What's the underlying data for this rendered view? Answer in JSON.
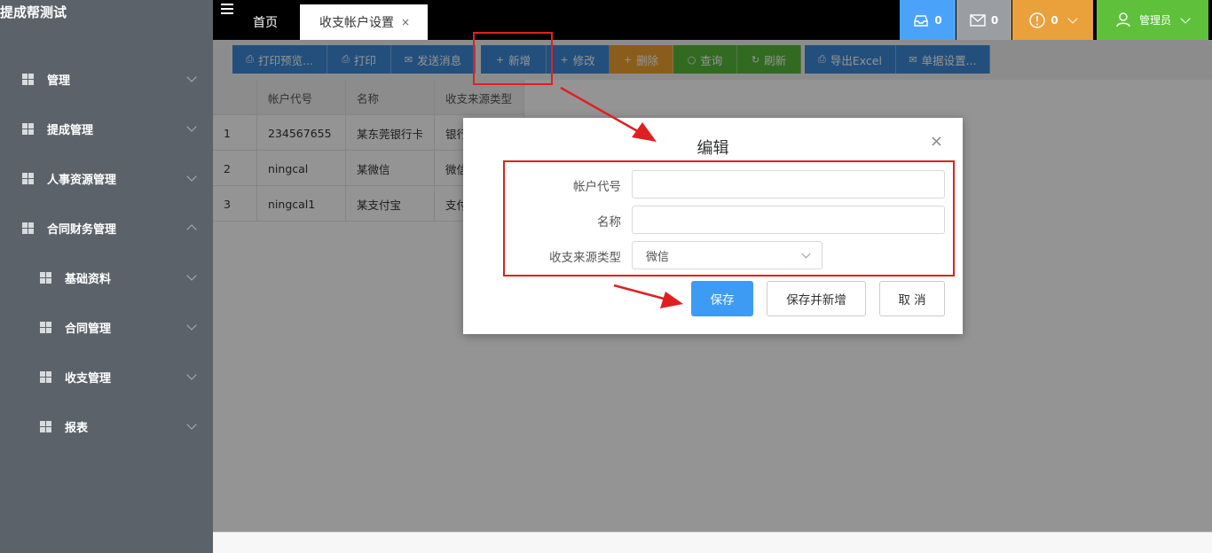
{
  "app": {
    "title": "提成帮测试"
  },
  "sidebar": {
    "items": [
      {
        "label": "管理",
        "expanded": false
      },
      {
        "label": "提成管理",
        "expanded": false
      },
      {
        "label": "人事资源管理",
        "expanded": false
      },
      {
        "label": "合同财务管理",
        "expanded": true
      },
      {
        "label": "基础资料",
        "expanded": false
      },
      {
        "label": "合同管理",
        "expanded": false
      },
      {
        "label": "收支管理",
        "expanded": false
      },
      {
        "label": "报表",
        "expanded": false
      }
    ]
  },
  "topbar": {
    "tabs": [
      {
        "label": "首页"
      },
      {
        "label": "收支帐户设置",
        "close": "×"
      }
    ],
    "inbox_count": "0",
    "mail_count": "0",
    "alert_count": "0",
    "user_label": "管理员"
  },
  "toolbar": {
    "buttons": [
      {
        "icon": "⎙",
        "label": "打印预览..."
      },
      {
        "icon": "⎙",
        "label": "打印"
      },
      {
        "icon": "✉",
        "label": "发送消息"
      },
      {
        "icon": "+",
        "label": "新增"
      },
      {
        "icon": "+",
        "label": "修改"
      },
      {
        "icon": "+",
        "label": "删除"
      },
      {
        "icon": "○",
        "label": "查询"
      },
      {
        "icon": "↻",
        "label": "刷新"
      },
      {
        "icon": "⎙",
        "label": "导出Excel"
      },
      {
        "icon": "✉",
        "label": "单据设置..."
      }
    ]
  },
  "table": {
    "headers": [
      "",
      "帐户代号",
      "名称",
      "收支来源类型"
    ],
    "rows": [
      [
        "1",
        "234567655",
        "某东莞银行卡",
        "银行"
      ],
      [
        "2",
        "ningcal",
        "某微信",
        "微信"
      ],
      [
        "3",
        "ningcal1",
        "某支付宝",
        "支付"
      ]
    ]
  },
  "modal": {
    "title": "编辑",
    "close": "×",
    "fields": {
      "account_code_label": "帐户代号",
      "account_code_value": "",
      "name_label": "名称",
      "name_value": "",
      "source_type_label": "收支来源类型",
      "source_type_value": "微信"
    },
    "buttons": {
      "save": "保存",
      "save_new": "保存并新增",
      "cancel": "取 消"
    }
  },
  "colors": {
    "sidebar_bg": "#5b6269",
    "primary": "#3d88d8",
    "warning": "#f0a033",
    "success": "#56b73b",
    "annotation": "#e02020"
  }
}
